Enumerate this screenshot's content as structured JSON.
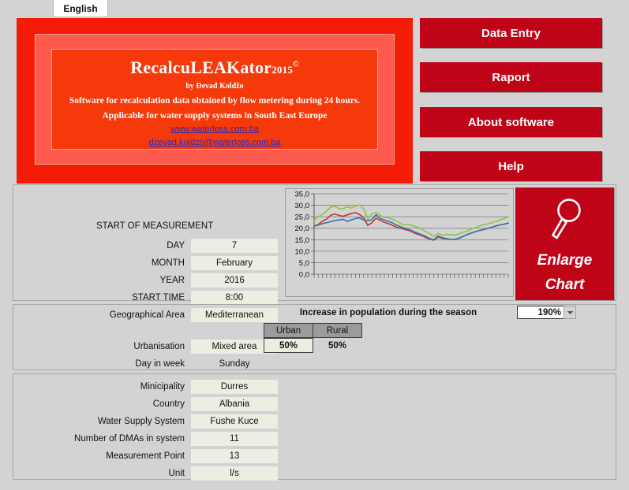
{
  "tab": {
    "label": "English"
  },
  "banner": {
    "title": "RecalcuLEAKator",
    "year": "2015",
    "copyright": "©",
    "author": "by Đevad Koldžo",
    "line1": "Software for recalculation data obtained by flow metering during 24 hours.",
    "line2": "Applicable for water supply systems in South East Europe",
    "website": "www.waterloss.com.ba",
    "email": "dzevad.koldzo@waterloss.com.ba"
  },
  "buttons": [
    {
      "label": "Data Entry"
    },
    {
      "label": "Raport"
    },
    {
      "label": "About software"
    },
    {
      "label": "Help"
    }
  ],
  "measurement": {
    "heading": "START OF MEASUREMENT",
    "fields": [
      {
        "label": "DAY",
        "value": "7"
      },
      {
        "label": "MONTH",
        "value": "February"
      },
      {
        "label": "YEAR",
        "value": "2016"
      },
      {
        "label": "START TIME",
        "value": "8:00"
      }
    ]
  },
  "enlarge_chart": {
    "line1": "Enlarge",
    "line2": "Chart",
    "icon": "magnifier-icon"
  },
  "geo": {
    "fields": [
      {
        "label": "Geographical Area",
        "value": "Mediterranean"
      },
      {
        "label": "Urbanisation",
        "value": "Mixed area"
      },
      {
        "label": "Day in week",
        "value": "Sunday"
      }
    ],
    "population_label": "Increase in population during the season",
    "population_value": "190%",
    "urban_rural": {
      "headers": [
        "Urban",
        "Rural"
      ],
      "values": [
        "50%",
        "50%"
      ]
    }
  },
  "location": {
    "fields": [
      {
        "label": "Minicipality",
        "value": "Durres"
      },
      {
        "label": "Country",
        "value": "Albania"
      },
      {
        "label": "Water Supply System",
        "value": "Fushe Kuce"
      },
      {
        "label": "Number of DMAs in system",
        "value": "11"
      },
      {
        "label": "Measurement Point",
        "value": "13"
      },
      {
        "label": "Unit",
        "value": "l/s"
      }
    ]
  },
  "colors": {
    "accent_red": "#c00418",
    "banner_red": "#f41c06",
    "banner_inner": "#f5390a",
    "panel_gray": "#d3d3d3",
    "field_cream": "#edede1",
    "series_green": "#8cc63e",
    "series_red": "#c0392b",
    "series_blue": "#3a6fb0"
  },
  "chart_data": {
    "type": "line",
    "title": "",
    "xlabel": "",
    "ylabel": "",
    "ylim": [
      0,
      35
    ],
    "yticks": [
      "0,0",
      "5,0",
      "10,0",
      "15,0",
      "20,0",
      "25,0",
      "30,0",
      "35,0"
    ],
    "grid": true,
    "legend": "none",
    "x_tick_count": 48,
    "series": [
      {
        "name": "series-green",
        "color": "#8cc63e",
        "values": [
          23.4,
          25.0,
          26.0,
          27.4,
          29.2,
          29.5,
          28.6,
          28.5,
          29.4,
          28.8,
          29.7,
          30.1,
          28.5,
          24.0,
          26.2,
          27.0,
          25.5,
          24.8,
          24.5,
          23.9,
          23.2,
          22.0,
          21.4,
          21.6,
          21.0,
          20.4,
          19.6,
          18.6,
          17.6,
          16.4,
          17.8,
          17.0,
          17.3,
          17.2,
          17.0,
          17.4,
          18.2,
          18.8,
          19.6,
          20.2,
          21.0,
          21.4,
          21.9,
          22.4,
          23.0,
          23.6,
          24.2,
          25.0
        ]
      },
      {
        "name": "series-red",
        "color": "#c0392b",
        "values": [
          20.9,
          21.6,
          23.0,
          24.0,
          25.6,
          26.2,
          25.6,
          25.2,
          25.8,
          26.4,
          26.8,
          26.0,
          24.5,
          21.2,
          22.4,
          24.4,
          23.4,
          22.6,
          22.0,
          21.2,
          20.4,
          20.0,
          19.4,
          19.0,
          18.2,
          17.4,
          16.8,
          16.0,
          15.2,
          14.8,
          16.2,
          15.6,
          15.4,
          15.2,
          15.1,
          15.6,
          16.4,
          17.2,
          17.9,
          18.5,
          19.0,
          19.4,
          19.9,
          20.4,
          21.0,
          21.4,
          21.8,
          22.2
        ]
      },
      {
        "name": "series-blue",
        "color": "#3a6fb0",
        "values": [
          20.9,
          21.4,
          22.0,
          22.4,
          22.9,
          23.3,
          23.6,
          23.9,
          23.0,
          23.6,
          24.2,
          24.5,
          23.6,
          23.3,
          23.7,
          25.9,
          24.2,
          23.6,
          23.0,
          22.3,
          21.3,
          20.6,
          20.0,
          19.4,
          18.6,
          17.9,
          17.2,
          16.5,
          15.5,
          15.0,
          16.6,
          15.9,
          15.5,
          15.2,
          15.1,
          15.6,
          16.4,
          17.2,
          17.9,
          18.5,
          19.0,
          19.4,
          19.9,
          20.4,
          21.0,
          21.4,
          21.8,
          22.2
        ]
      }
    ]
  }
}
